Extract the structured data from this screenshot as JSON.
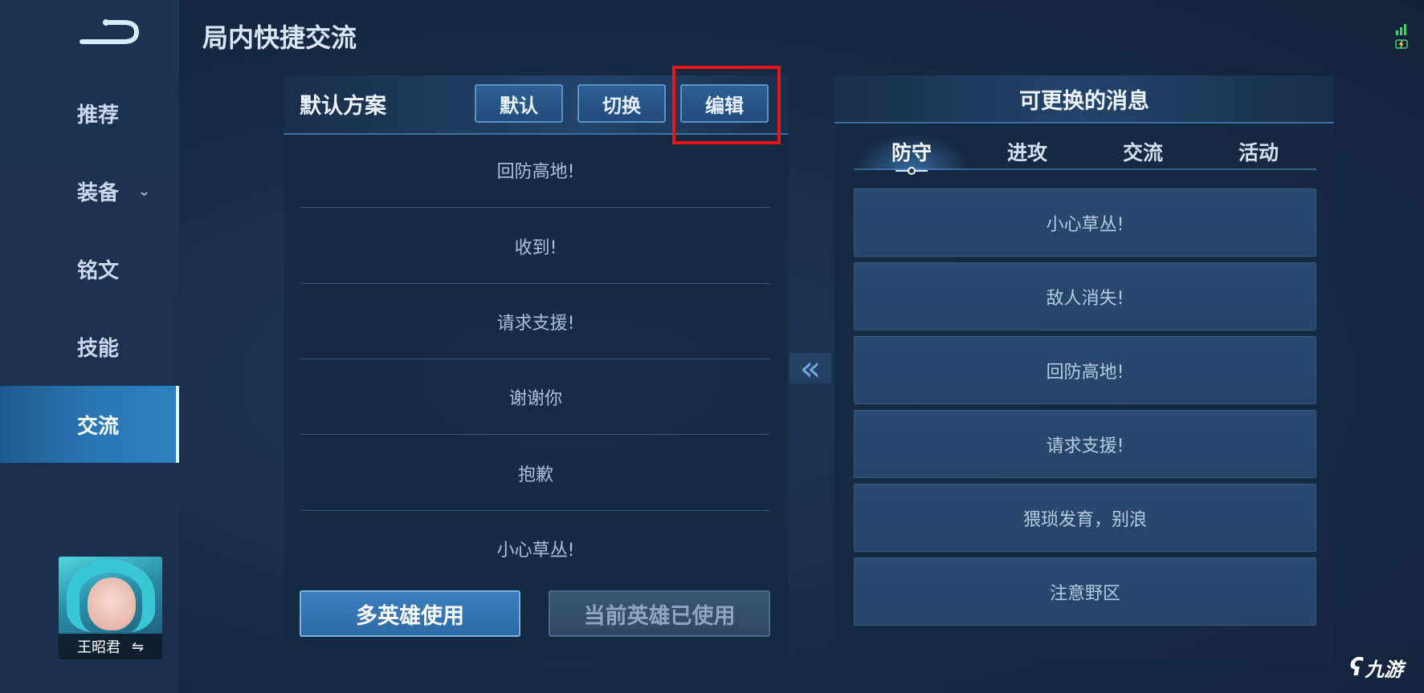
{
  "header": {
    "title": "局内快捷交流",
    "back_icon": "back-arrow-icon"
  },
  "sidebar": {
    "items": [
      {
        "label": "推荐"
      },
      {
        "label": "装备",
        "expand_icon": "chevron-down-icon"
      },
      {
        "label": "铭文"
      },
      {
        "label": "技能"
      },
      {
        "label": "交流",
        "active": true
      }
    ],
    "hero": {
      "name": "王昭君",
      "swap_icon": "swap-icon",
      "swap_glyph": "⇋"
    }
  },
  "left_panel": {
    "scheme_label": "默认方案",
    "buttons": {
      "default": "默认",
      "switch": "切换",
      "edit": "编辑"
    },
    "messages": [
      "回防高地!",
      "收到!",
      "请求支援!",
      "谢谢你",
      "抱歉",
      "小心草丛!"
    ],
    "multi_hero_button": "多英雄使用",
    "current_hero_button": "当前英雄已使用"
  },
  "transfer_arrow": "«",
  "right_panel": {
    "title": "可更换的消息",
    "tabs": [
      "防守",
      "进攻",
      "交流",
      "活动"
    ],
    "active_tab": "防守",
    "messages": [
      "小心草丛!",
      "敌人消失!",
      "回防高地!",
      "请求支援!",
      "猥琐发育，别浪",
      "注意野区"
    ]
  },
  "watermark": {
    "text": "九游",
    "logo_glyph": "ʕ"
  },
  "colors": {
    "highlight": "#e8161c",
    "accent": "#2c7fc0"
  }
}
